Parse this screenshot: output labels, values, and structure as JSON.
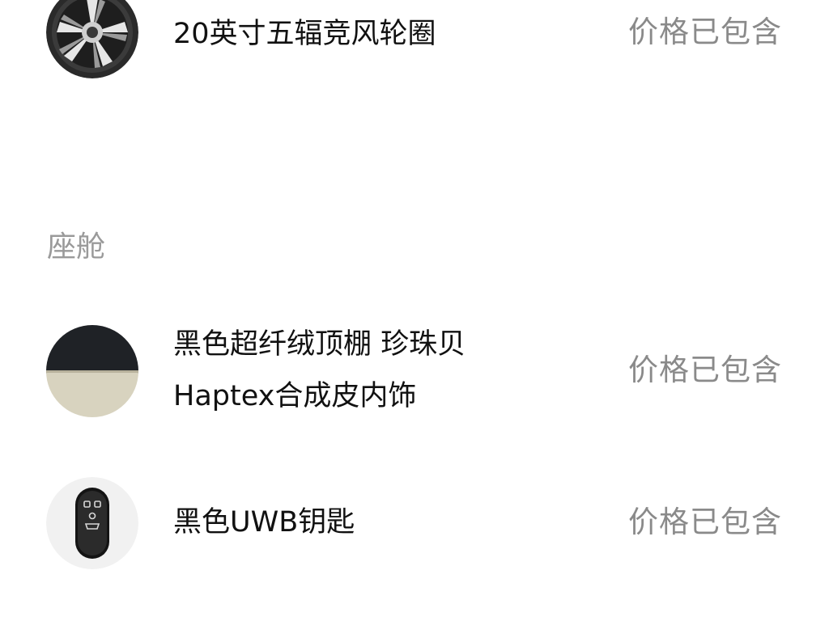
{
  "items_top": [
    {
      "name": "20英寸五辐竞风轮圈",
      "price_note": "价格已包含",
      "icon": "wheel-icon"
    }
  ],
  "cabin": {
    "section_title": "座舱",
    "items": [
      {
        "name_line1": "黑色超纤绒顶棚 珍珠贝",
        "name_line2": "Haptex合成皮内饰",
        "price_note": "价格已包含",
        "icon": "interior-swatch-icon"
      },
      {
        "name": "黑色UWB钥匙",
        "price_note": "价格已包含",
        "icon": "uwb-key-icon"
      }
    ]
  }
}
